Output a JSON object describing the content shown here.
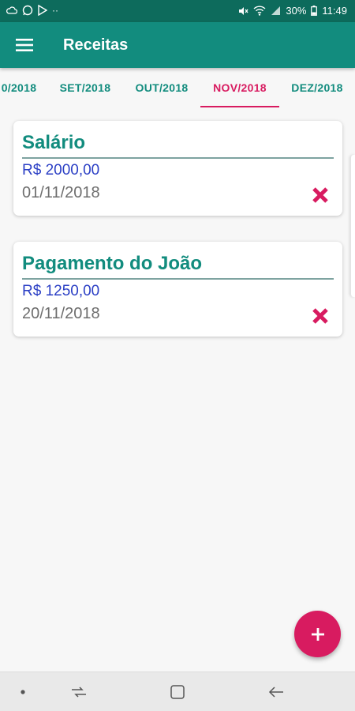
{
  "status_bar": {
    "time": "11:49",
    "battery": "30%",
    "left_icons": [
      "cloud-icon",
      "whatsapp-icon",
      "play-store-icon",
      "more-dots-icon"
    ],
    "right_icons": [
      "mute-icon",
      "wifi-icon",
      "signal-icon",
      "battery-icon"
    ]
  },
  "app_bar": {
    "title": "Receitas",
    "menu_icon": "hamburger-menu-icon",
    "color": "#128c7e"
  },
  "tabs": [
    {
      "label": "0/2018",
      "active": false
    },
    {
      "label": "SET/2018",
      "active": false
    },
    {
      "label": "OUT/2018",
      "active": false
    },
    {
      "label": "NOV/2018",
      "active": true
    },
    {
      "label": "DEZ/2018",
      "active": false
    }
  ],
  "cards": [
    {
      "title": "Salário",
      "value": "R$ 2000,00",
      "date": "01/11/2018"
    },
    {
      "title": "Pagamento do João",
      "value": "R$ 1250,00",
      "date": "20/11/2018"
    }
  ],
  "fab": {
    "icon": "plus-icon",
    "color": "#d81b60"
  },
  "nav_bar": {
    "icons": [
      "dot-icon",
      "recent-apps-icon",
      "home-icon",
      "back-icon"
    ]
  },
  "colors": {
    "primary": "#128c7e",
    "status_bar": "#0d6b5c",
    "accent": "#d81b60",
    "value_text": "#2b3fc5"
  }
}
